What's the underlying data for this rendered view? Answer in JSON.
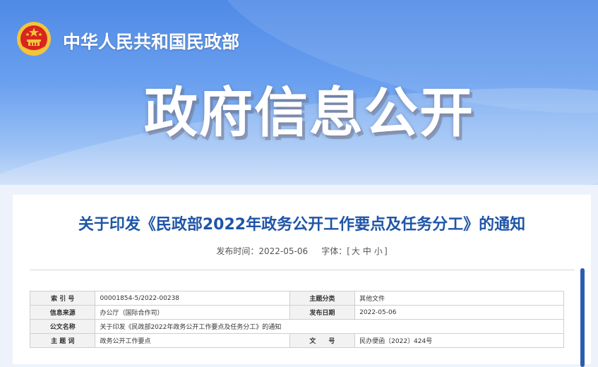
{
  "header": {
    "ministry_name": "中华人民共和国民政部",
    "banner_title": "政府信息公开"
  },
  "article": {
    "title": "关于印发《民政部2022年政务公开工作要点及任务分工》的通知",
    "publish_label": "发布时间：",
    "publish_date": "2022-05-06",
    "font_label": "字体：[",
    "font_large": "大",
    "font_medium": "中",
    "font_small": "小",
    "font_close": "]"
  },
  "info_table": {
    "rows": [
      {
        "l1": "索 引 号",
        "v1": "00001854-5/2022-00238",
        "l2": "主题分类",
        "v2": "其他文件"
      },
      {
        "l1": "信息来源",
        "v1": "办公厅（国际合作司）",
        "l2": "发布日期",
        "v2": "2022-05-06"
      },
      {
        "l1": "公文名称",
        "v1": "关于印发《民政部2022年政务公开工作要点及任务分工》的通知"
      },
      {
        "l1": "主 题 词",
        "v1": "政务公开工作要点",
        "l2": "文　　号",
        "v2": "民办便函〔2022〕424号"
      }
    ]
  },
  "colors": {
    "title_blue": "#1f55a8",
    "banner_blue": "#4f8ae6",
    "emblem_red": "#d7261e",
    "emblem_gold": "#f3c43c"
  },
  "icons": {
    "emblem": "national-emblem-icon"
  }
}
